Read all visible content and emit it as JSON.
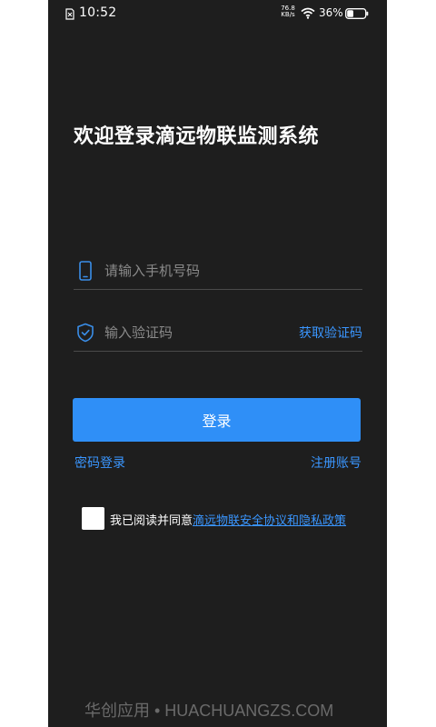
{
  "status_bar": {
    "time": "10:52",
    "net_speed_value": "76.8",
    "net_speed_unit": "KB/s",
    "battery_percent": "36%",
    "battery_level": 0.36
  },
  "title": "欢迎登录滴远物联监测系统",
  "phone_field": {
    "placeholder": "请输入手机号码",
    "value": "",
    "icon": "phone-icon"
  },
  "code_field": {
    "placeholder": "输入验证码",
    "value": "",
    "icon": "shield-check-icon",
    "get_code_label": "获取验证码"
  },
  "login_button_label": "登录",
  "links": {
    "password_login": "密码登录",
    "register": "注册账号"
  },
  "agreement": {
    "prefix": "我已阅读并同意",
    "link_text": "滴远物联安全协议和隐私政策",
    "checked": false
  },
  "watermark": "华创应用 • HUACHUANGZS.COM",
  "colors": {
    "background": "#1e1e1e",
    "accent": "#2f8ff7",
    "link": "#3a96ff",
    "placeholder": "#8a8a8a"
  }
}
